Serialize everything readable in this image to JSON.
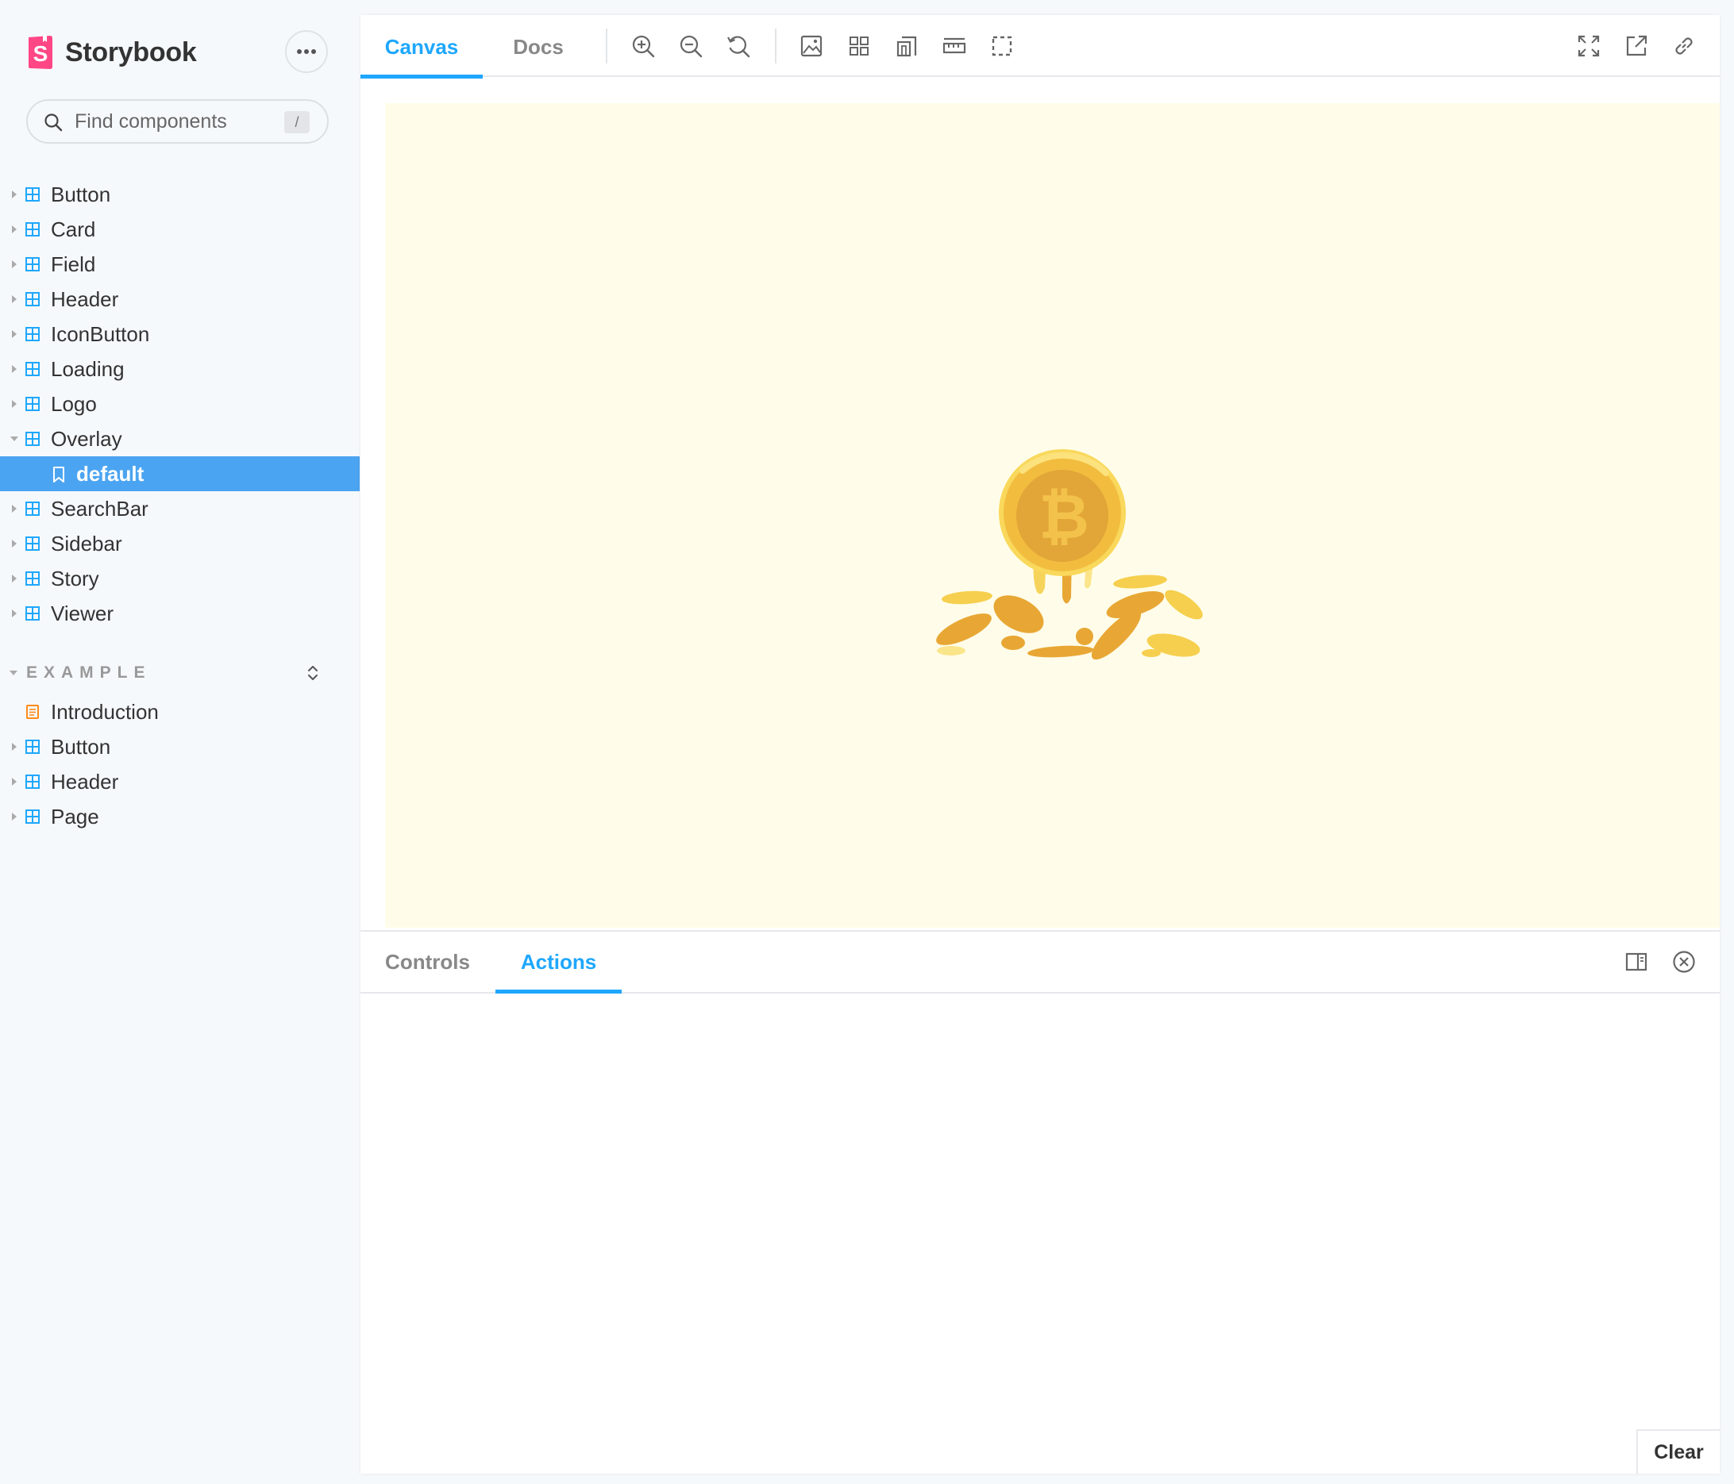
{
  "brand": {
    "name": "Storybook",
    "logo_color": "#ff4785"
  },
  "search": {
    "placeholder": "Find components",
    "shortcut": "/"
  },
  "sidebar": {
    "components": [
      {
        "label": "Button"
      },
      {
        "label": "Card"
      },
      {
        "label": "Field"
      },
      {
        "label": "Header"
      },
      {
        "label": "IconButton"
      },
      {
        "label": "Loading"
      },
      {
        "label": "Logo"
      },
      {
        "label": "Overlay",
        "expanded": true
      },
      {
        "label": "default",
        "selected": true
      },
      {
        "label": "SearchBar"
      },
      {
        "label": "Sidebar"
      },
      {
        "label": "Story"
      },
      {
        "label": "Viewer"
      }
    ],
    "section_title": "EXAMPLE",
    "example_items": [
      {
        "label": "Introduction",
        "icon": "document-icon"
      },
      {
        "label": "Button"
      },
      {
        "label": "Header"
      },
      {
        "label": "Page"
      }
    ]
  },
  "toolbar": {
    "tabs": [
      {
        "label": "Canvas",
        "active": true
      },
      {
        "label": "Docs"
      }
    ],
    "tools": [
      "zoom-in-icon",
      "zoom-out-icon",
      "zoom-reset-icon",
      "background-icon",
      "grid-icon",
      "viewport-icon",
      "measure-icon",
      "outline-icon"
    ],
    "right_tools": [
      "fullscreen-icon",
      "open-new-tab-icon",
      "copy-link-icon"
    ]
  },
  "canvas": {
    "background": "#fffde9",
    "illustration": "bitcoin-coin-illustration"
  },
  "addons": {
    "tabs": [
      {
        "label": "Controls"
      },
      {
        "label": "Actions",
        "active": true
      }
    ],
    "clear_label": "Clear"
  },
  "colors": {
    "accent": "#1ea7fd",
    "selected": "#4ba4f1",
    "component_icon": "#1ea7fd",
    "doc_icon": "#ff8c1a",
    "coin": "#f2b83b"
  }
}
